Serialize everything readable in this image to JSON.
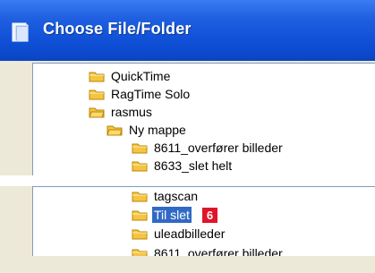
{
  "window": {
    "title": "Choose File/Folder",
    "titlebar_color": "#0f4fd6"
  },
  "tree_top": {
    "items": [
      {
        "label": "QuickTime"
      },
      {
        "label": "RagTime Solo"
      },
      {
        "label": "rasmus"
      },
      {
        "label": "Ny mappe"
      },
      {
        "label": "8611_overfører billeder"
      },
      {
        "label": "8633_slet helt"
      }
    ]
  },
  "tree_bottom": {
    "items": [
      {
        "label": "tagscan"
      },
      {
        "label": "Til slet",
        "selected": true,
        "badge": "6"
      },
      {
        "label": "uleadbilleder"
      },
      {
        "label": "8611_overfører billeder"
      }
    ]
  },
  "colors": {
    "selection": "#316ac5",
    "badge": "#e0142a",
    "folder": "#f5c542"
  },
  "icons": {
    "folder": "folder-icon",
    "title": "window-app-icon"
  }
}
